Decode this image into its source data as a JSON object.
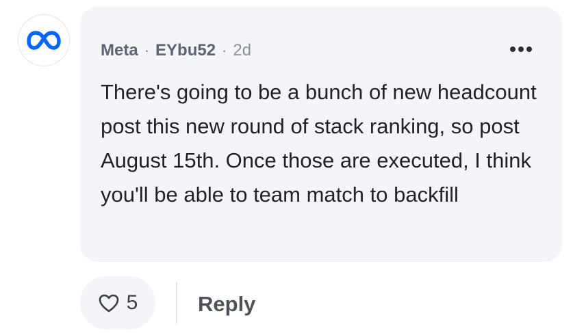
{
  "comment": {
    "author_company": "Meta",
    "separator": "·",
    "author_username": "EYbu52",
    "time_ago": "2d",
    "text": "There's going to be a bunch of new headcount post this new round of stack ranking, so post August 15th. Once those are executed, I think you'll be able to team match to backfill"
  },
  "actions": {
    "like_count": "5",
    "reply_label": "Reply"
  },
  "icons": {
    "avatar": "meta-logo-icon",
    "more": "more-options-icon",
    "like": "heart-icon"
  },
  "colors": {
    "bubble_bg": "#f4f5f8",
    "meta_blue": "#0866ff",
    "text": "#1f2329"
  }
}
